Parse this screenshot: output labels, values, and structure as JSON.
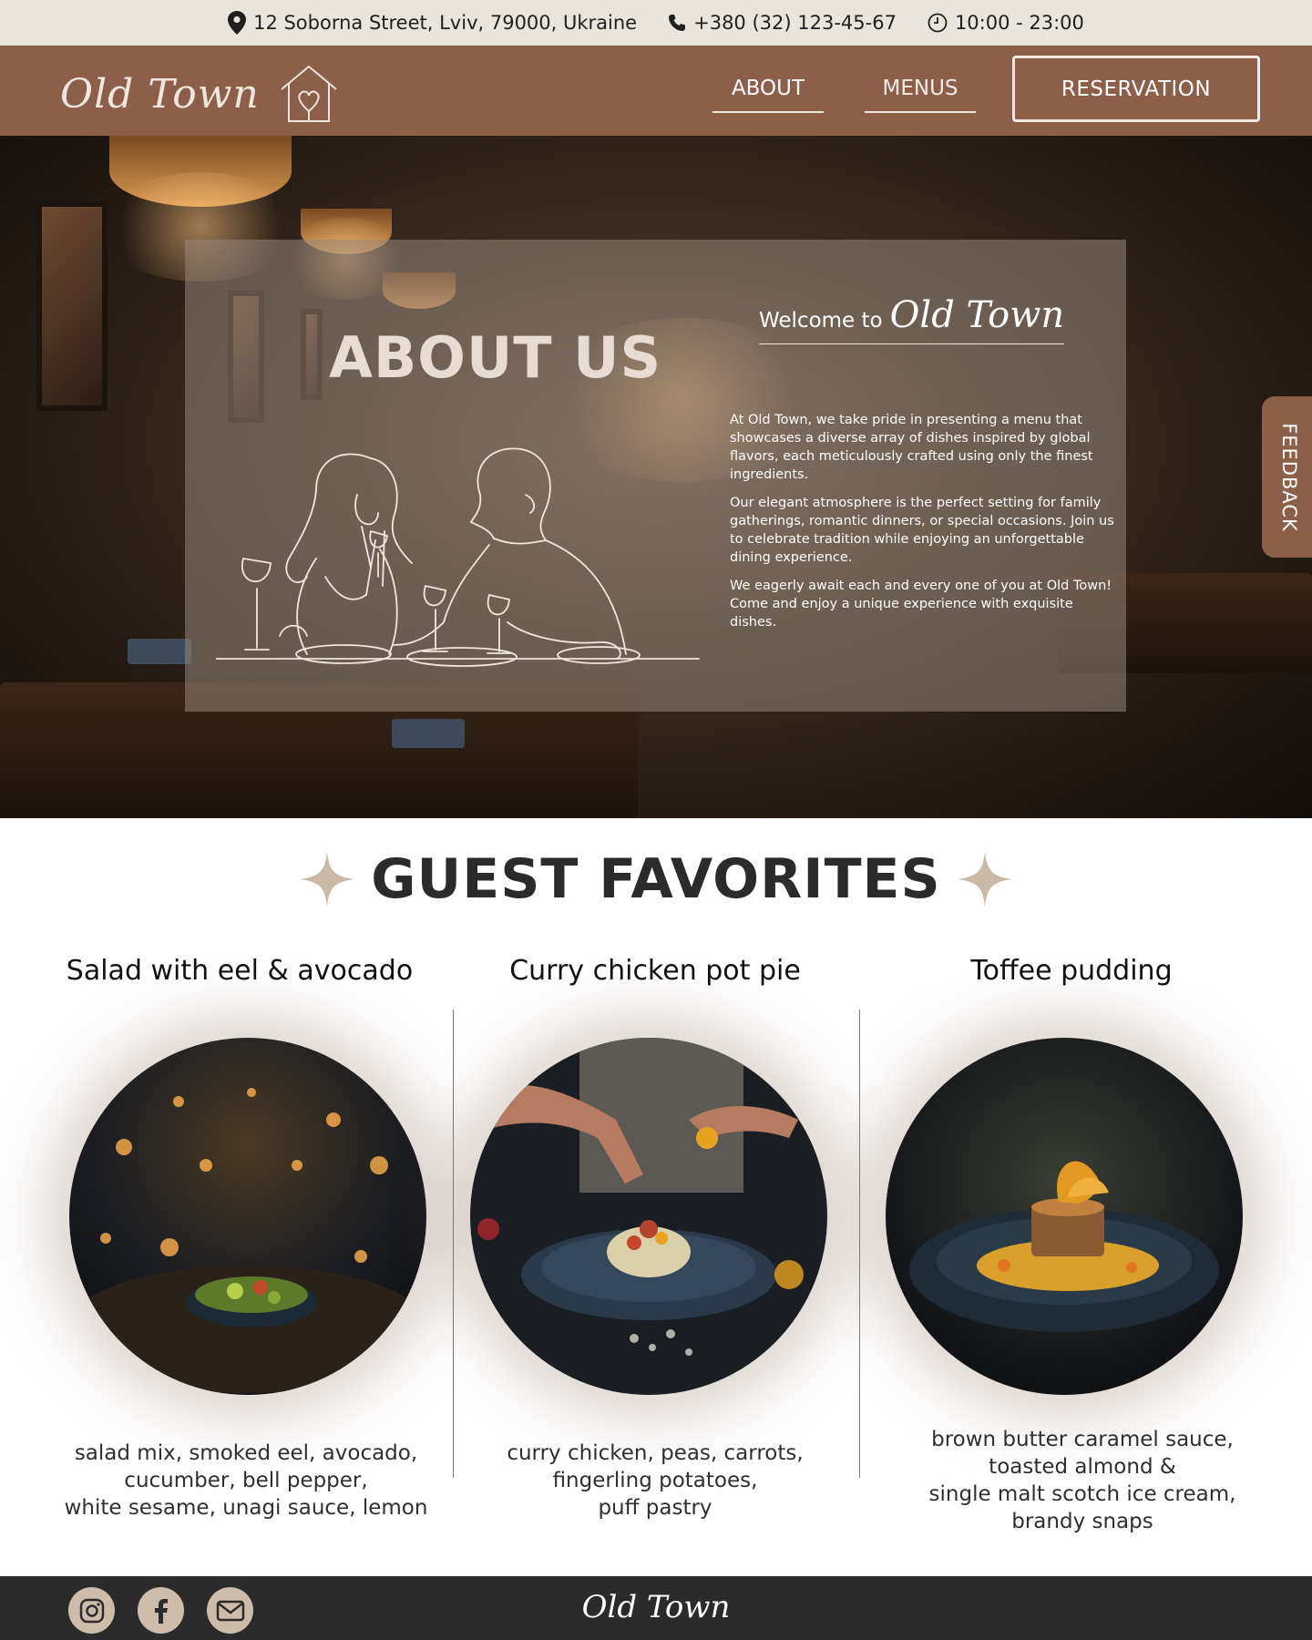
{
  "topbar": {
    "address": "12 Soborna Street, Lviv, 79000, Ukraine",
    "phone": "+380 (32) 123-45-67",
    "hours": "10:00 - 23:00",
    "address_icon": "location-pin-icon",
    "phone_icon": "phone-icon",
    "hours_icon": "clock-icon"
  },
  "header": {
    "logo_text": "Old Town",
    "logo_icon": "house-heart-icon",
    "nav": [
      "ABOUT",
      "MENUS"
    ],
    "reservation_label": "RESERVATION"
  },
  "hero": {
    "title": "ABOUT US",
    "welcome_prefix": "Welcome to",
    "welcome_script": "Old Town",
    "paragraphs": [
      "At Old Town, we take pride in presenting a menu that showcases a diverse array of dishes inspired by global flavors, each meticulously crafted using only the finest ingredients.",
      "Our elegant atmosphere is the perfect setting for family gatherings, romantic dinners, or special occasions. Join us to celebrate tradition while enjoying an unforgettable dining experience.",
      "We eagerly await each and every one of you at Old Town! Come and enjoy a unique experience with exquisite dishes."
    ],
    "feedback_label": "FEEDBACK",
    "illustration": "couple-dining-line-art"
  },
  "favorites": {
    "heading": "GUEST FAVORITES",
    "dishes": [
      {
        "title": "Salad with eel & avocado",
        "description_lines": [
          "salad mix, smoked eel, avocado,",
          "cucumber, bell pepper,",
          "white sesame, unagi sauce, lemon"
        ]
      },
      {
        "title": "Curry chicken pot pie",
        "description_lines": [
          "curry chicken, peas, carrots,",
          "fingerling potatoes,",
          "puff pastry"
        ]
      },
      {
        "title": "Toffee pudding",
        "description_lines": [
          "brown butter caramel sauce,",
          "toasted almond &",
          "single malt scotch ice cream,",
          "brandy snaps"
        ]
      }
    ]
  },
  "footer": {
    "logo_text": "Old Town",
    "social_icons": [
      "instagram-icon",
      "facebook-icon",
      "mail-icon"
    ]
  },
  "colors": {
    "brand_brown": "#8d5f49",
    "topbar_bg": "#e9e4dc",
    "footer_bg": "#2b2b2b",
    "accent_beige": "#cdbca9"
  }
}
